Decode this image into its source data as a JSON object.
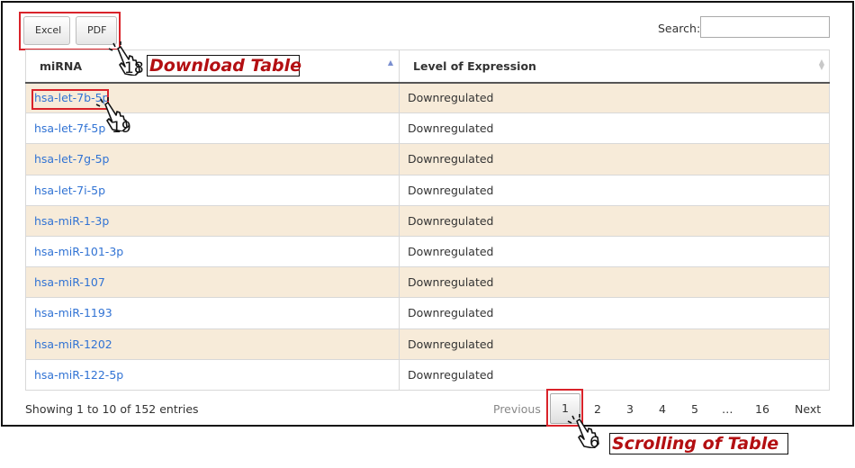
{
  "toolbar": {
    "excel_label": "Excel",
    "pdf_label": "PDF"
  },
  "search": {
    "label": "Search:",
    "value": ""
  },
  "table": {
    "headers": [
      "miRNA",
      "Level of Expression"
    ],
    "sort_column": "miRNA",
    "rows": [
      {
        "mirna": "hsa-let-7b-5p",
        "level": "Downregulated"
      },
      {
        "mirna": "hsa-let-7f-5p",
        "level": "Downregulated"
      },
      {
        "mirna": "hsa-let-7g-5p",
        "level": "Downregulated"
      },
      {
        "mirna": "hsa-let-7i-5p",
        "level": "Downregulated"
      },
      {
        "mirna": "hsa-miR-1-3p",
        "level": "Downregulated"
      },
      {
        "mirna": "hsa-miR-101-3p",
        "level": "Downregulated"
      },
      {
        "mirna": "hsa-miR-107",
        "level": "Downregulated"
      },
      {
        "mirna": "hsa-miR-1193",
        "level": "Downregulated"
      },
      {
        "mirna": "hsa-miR-1202",
        "level": "Downregulated"
      },
      {
        "mirna": "hsa-miR-122-5p",
        "level": "Downregulated"
      }
    ]
  },
  "info": "Showing 1 to 10 of 152 entries",
  "pagination": {
    "previous": "Previous",
    "pages": [
      "1",
      "2",
      "3",
      "4",
      "5",
      "…",
      "16"
    ],
    "current": "1",
    "next": "Next"
  },
  "annotations": {
    "download": {
      "step": "18",
      "label": "Download Table"
    },
    "link": {
      "step": "19"
    },
    "scroll": {
      "step": "6",
      "label": "Scrolling of Table"
    }
  },
  "colors": {
    "highlight": "#d9232a",
    "callout_text": "#b30f12",
    "link": "#3173d4",
    "row_odd": "#f7ebd9"
  },
  "icons": [
    "pointing-hand-icon",
    "sort-ascending-icon",
    "sort-both-icon"
  ]
}
